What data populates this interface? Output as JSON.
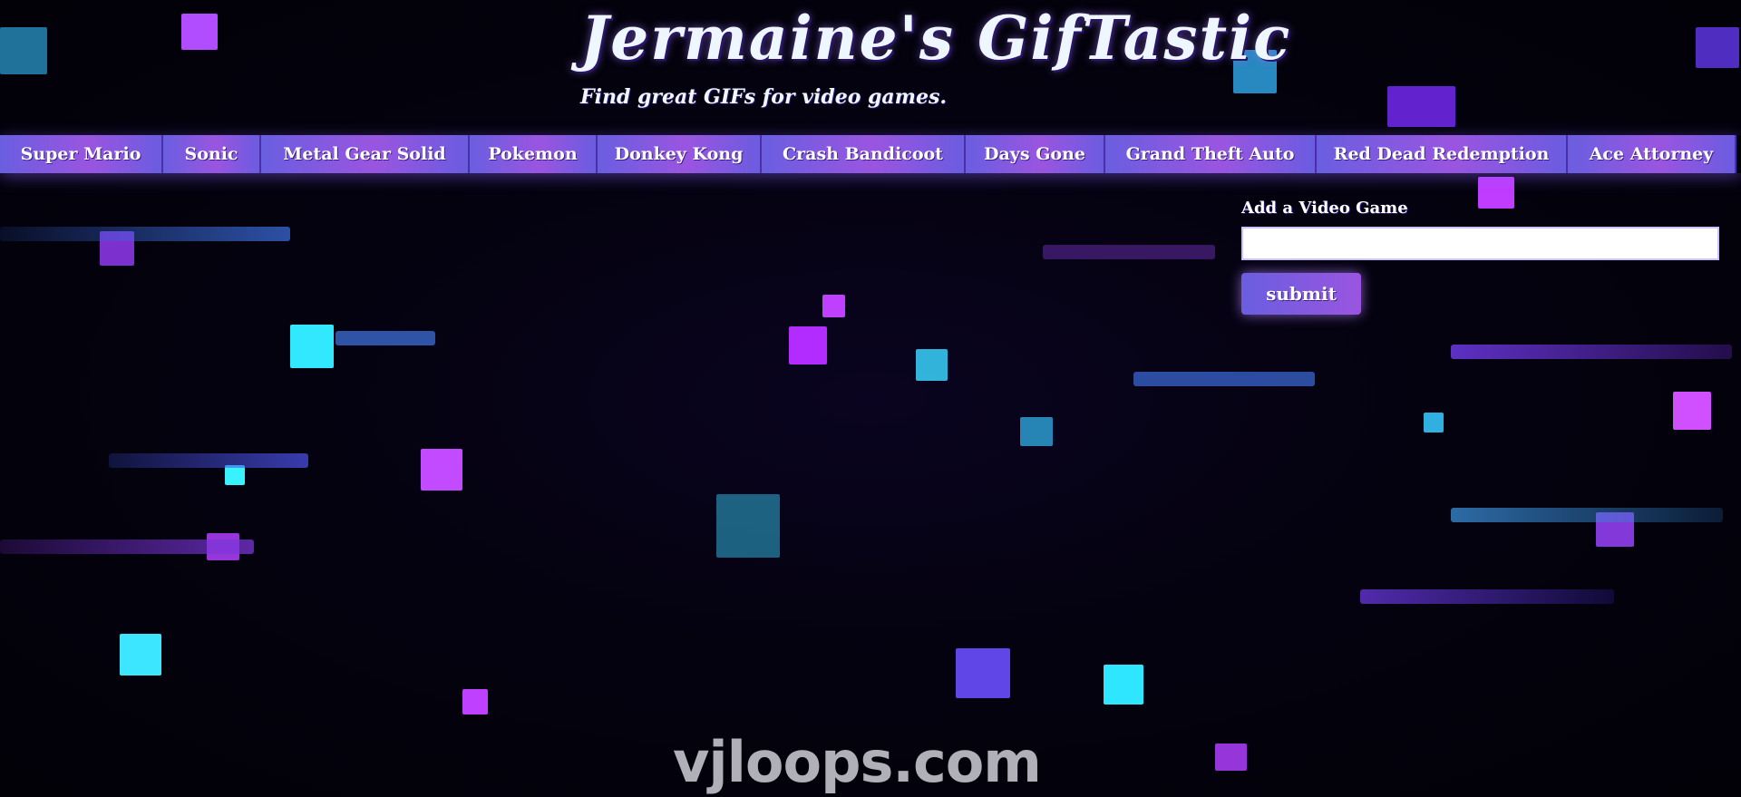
{
  "header": {
    "title": "Jermaine's GifTastic",
    "subtitle": "Find great GIFs for video games."
  },
  "nav": {
    "buttons": [
      "Super Mario",
      "Sonic",
      "Metal Gear Solid",
      "Pokemon",
      "Donkey Kong",
      "Crash Bandicoot",
      "Days Gone",
      "Grand Theft Auto",
      "Red Dead Redemption",
      "Ace Attorney"
    ]
  },
  "form": {
    "label": "Add a Video Game",
    "input_value": "",
    "submit_label": "submit"
  },
  "background": {
    "watermark": "vjloops.com"
  },
  "colors": {
    "accent_violet": "#9a55e0",
    "accent_blue": "#6a5ee0",
    "background": "#03010a",
    "text": "#eef7ff"
  }
}
